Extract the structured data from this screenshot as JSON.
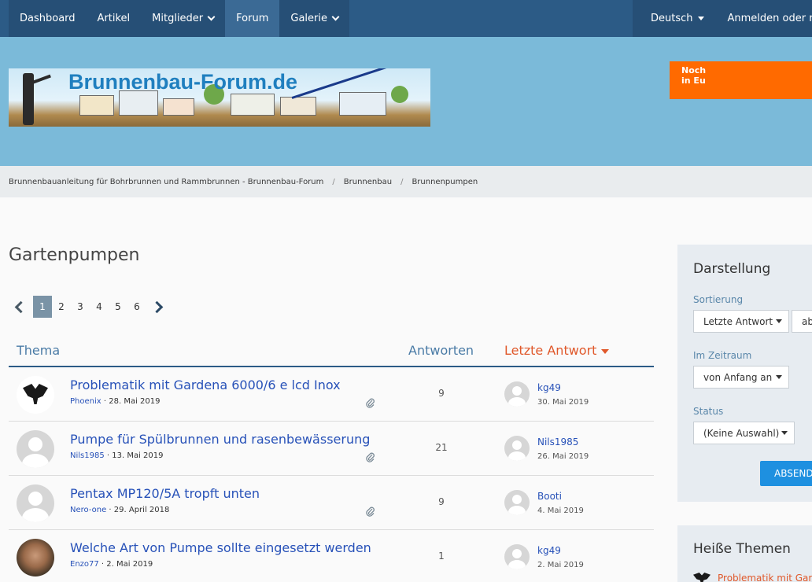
{
  "nav": {
    "items": [
      {
        "label": "Dashboard",
        "dropdown": false,
        "active": false
      },
      {
        "label": "Artikel",
        "dropdown": false,
        "active": false
      },
      {
        "label": "Mitglieder",
        "dropdown": true,
        "active": false
      },
      {
        "label": "Forum",
        "dropdown": false,
        "active": true
      },
      {
        "label": "Galerie",
        "dropdown": true,
        "active": false
      }
    ],
    "language": "Deutsch",
    "login": "Anmelden oder r"
  },
  "header": {
    "logo_text": "Brunnenbau-Forum.de",
    "ad_line1": "Noch",
    "ad_line2": "in Eu",
    "ad_color": "#ff6a00"
  },
  "breadcrumb": [
    "Brunnenbauanleitung für Bohrbrunnen und Rammbrunnen - Brunnenbau-Forum",
    "Brunnenbau",
    "Brunnenpumpen"
  ],
  "page": {
    "title": "Gartenpumpen"
  },
  "pagination": {
    "pages": [
      "1",
      "2",
      "3",
      "4",
      "5",
      "6"
    ],
    "current": "1"
  },
  "table": {
    "col_topic": "Thema",
    "col_replies": "Antworten",
    "col_last": "Letzte Antwort",
    "rows": [
      {
        "title": "Problematik mit Gardena 6000/6 e lcd Inox",
        "author": "Phoenix",
        "date": "28. Mai 2019",
        "replies": "9",
        "last_user": "kg49",
        "last_date": "30. Mai 2019",
        "avatar": "eagle",
        "attachment": true
      },
      {
        "title": "Pumpe für Spülbrunnen und rasenbewässerung",
        "author": "Nils1985",
        "date": "13. Mai 2019",
        "replies": "21",
        "last_user": "Nils1985",
        "last_date": "26. Mai 2019",
        "avatar": "default",
        "attachment": true
      },
      {
        "title": "Pentax MP120/5A tropft unten",
        "author": "Nero-one",
        "date": "29. April 2018",
        "replies": "9",
        "last_user": "Booti",
        "last_date": "4. Mai 2019",
        "avatar": "default",
        "attachment": true
      },
      {
        "title": "Welche Art von Pumpe sollte eingesetzt werden",
        "author": "Enzo77",
        "date": "2. Mai 2019",
        "replies": "1",
        "last_user": "kg49",
        "last_date": "2. Mai 2019",
        "avatar": "photo",
        "attachment": false
      }
    ]
  },
  "sidebar": {
    "title": "Darstellung",
    "sort_label": "Sortierung",
    "sort_value": "Letzte Antwort",
    "sort_dir": "ab",
    "period_label": "Im Zeitraum",
    "period_value": "von Anfang an",
    "status_label": "Status",
    "status_value": "(Keine Auswahl)",
    "apply_label": "ABSEND",
    "hot_title": "Heiße Themen",
    "hot_item": "Problematik mit Gard"
  },
  "colors": {
    "nav_bg": "#2c5b86",
    "header_bg": "#7bbad9",
    "link": "#2751b8",
    "accent": "#e0582a",
    "button": "#1e90e0"
  }
}
